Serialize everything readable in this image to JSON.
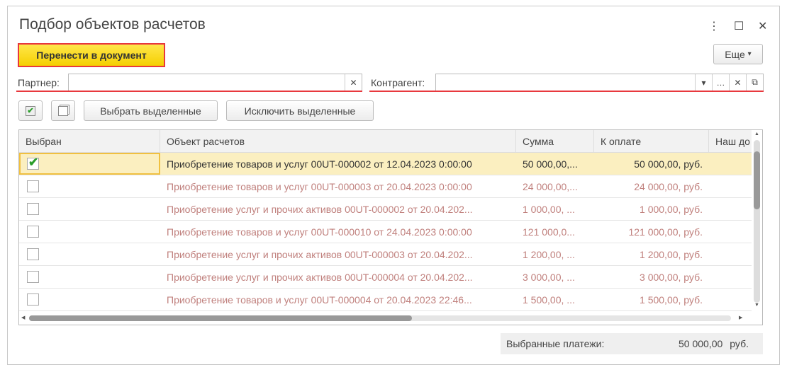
{
  "window": {
    "title": "Подбор объектов расчетов",
    "more_icon": "⋮",
    "maximize_icon": "☐",
    "close_icon": "✕"
  },
  "toolbar": {
    "transfer_label": "Перенести в документ",
    "more_label": "Еще",
    "more_arrow": "▾",
    "check_all_icon": "check-all",
    "uncheck_all_icon": "uncheck-all",
    "select_label": "Выбрать выделенные",
    "exclude_label": "Исключить выделенные"
  },
  "filters": {
    "partner_label": "Партнер:",
    "partner_value": "",
    "contractor_label": "Контрагент:",
    "contractor_value": ""
  },
  "grid": {
    "columns": [
      "Выбран",
      "Объект расчетов",
      "Сумма",
      "К оплате",
      "Наш до"
    ],
    "rows": [
      {
        "checked": true,
        "object": "Приобретение товаров и услуг 00UT-000002 от 12.04.2023 0:00:00",
        "sum": "50 000,00,...",
        "pay": "50 000,00, руб."
      },
      {
        "checked": false,
        "object": "Приобретение товаров и услуг 00UT-000003 от 20.04.2023 0:00:00",
        "sum": "24 000,00,...",
        "pay": "24 000,00, руб."
      },
      {
        "checked": false,
        "object": "Приобретение услуг и прочих активов 00UT-000002 от 20.04.202...",
        "sum": "1 000,00, ...",
        "pay": "1 000,00, руб."
      },
      {
        "checked": false,
        "object": "Приобретение товаров и услуг 00UT-000010 от 24.04.2023 0:00:00",
        "sum": "121 000,0...",
        "pay": "121 000,00, руб."
      },
      {
        "checked": false,
        "object": "Приобретение услуг и прочих активов 00UT-000003 от 20.04.202...",
        "sum": "1 200,00, ...",
        "pay": "1 200,00, руб."
      },
      {
        "checked": false,
        "object": "Приобретение услуг и прочих активов 00UT-000004 от 20.04.202...",
        "sum": "3 000,00, ...",
        "pay": "3 000,00, руб."
      },
      {
        "checked": false,
        "object": "Приобретение товаров и услуг 00UT-000004 от 20.04.2023 22:46...",
        "sum": "1 500,00, ...",
        "pay": "1 500,00, руб."
      }
    ]
  },
  "footer": {
    "label": "Выбранные платежи:",
    "value": "50 000,00",
    "currency": "руб."
  },
  "colors": {
    "accent": "#f5cf00",
    "highlight": "#e8383d",
    "row_selected": "#fbefc0",
    "row_text": "#c0807d"
  }
}
